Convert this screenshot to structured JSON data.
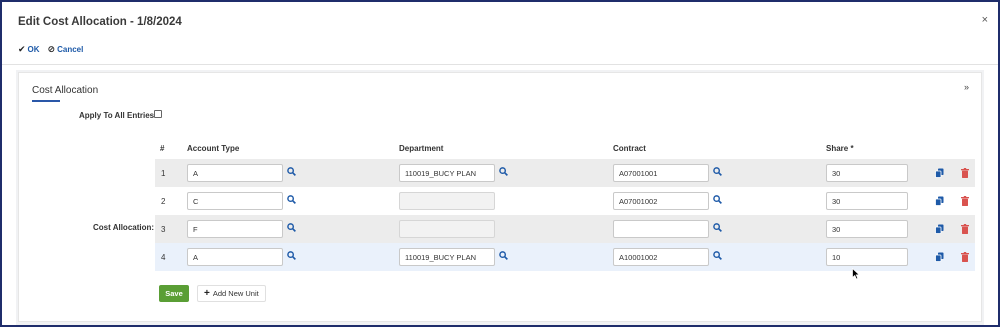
{
  "dialog": {
    "title": "Edit Cost Allocation - 1/8/2024",
    "close_glyph": "×"
  },
  "actions": {
    "ok_label": "OK",
    "cancel_label": "Cancel"
  },
  "section": {
    "title": "Cost Allocation",
    "collapse_glyph": "»"
  },
  "apply_all": {
    "label": "Apply To All Entries:",
    "checked": false
  },
  "cost_allocation_label": "Cost Allocation:",
  "table": {
    "headers": {
      "num": "#",
      "account_type": "Account Type",
      "department": "Department",
      "contract": "Contract",
      "share": "Share *"
    },
    "rows": [
      {
        "num": "1",
        "account_type": "A",
        "department": "110019_BUCY PLAN",
        "contract": "A07001001",
        "share": "30"
      },
      {
        "num": "2",
        "account_type": "C",
        "department": "",
        "contract": "A07001002",
        "share": "30"
      },
      {
        "num": "3",
        "account_type": "F",
        "department": "",
        "contract": "",
        "share": "30"
      },
      {
        "num": "4",
        "account_type": "A",
        "department": "110019_BUCY PLAN",
        "contract": "A10001002",
        "share": "10"
      }
    ]
  },
  "buttons": {
    "save": "Save",
    "add_new_unit": "Add New Unit"
  },
  "colors": {
    "accent_blue": "#1e5aa8",
    "save_green": "#5a9e35",
    "delete_red": "#d9534f",
    "border_navy": "#1f2d6b"
  }
}
